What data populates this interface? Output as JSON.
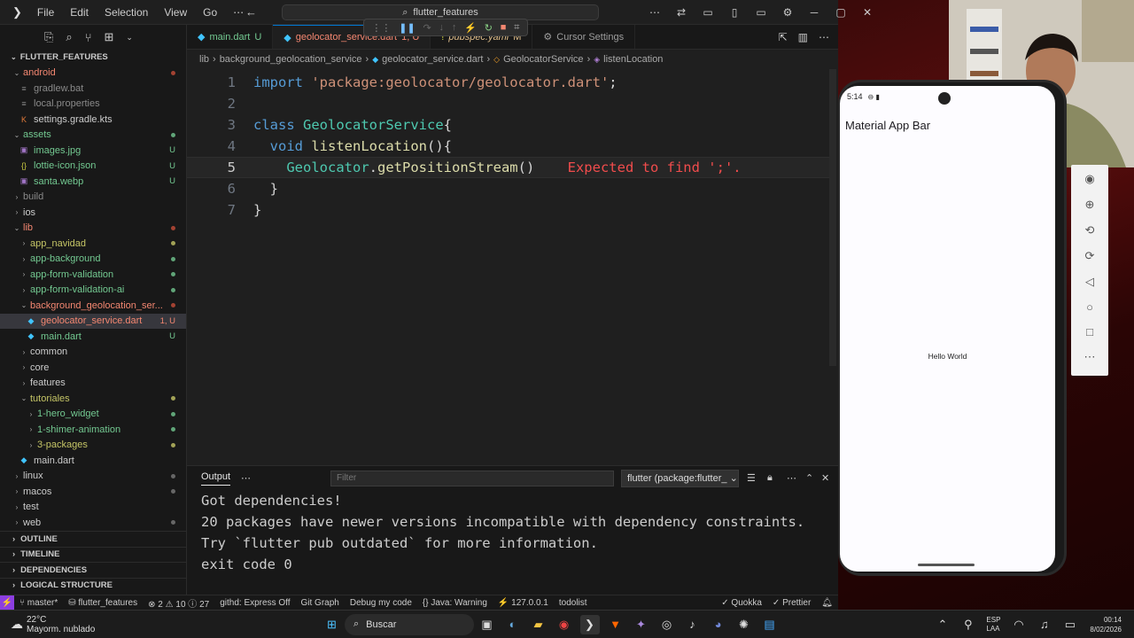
{
  "menu": {
    "items": [
      "File",
      "Edit",
      "Selection",
      "View",
      "Go",
      "⋯"
    ]
  },
  "search": {
    "text": "flutter_features"
  },
  "tabs": [
    {
      "label": "main.dart",
      "status": "U"
    },
    {
      "label": "geolocator_service.dart",
      "status": "1, U"
    },
    {
      "label": "pubspec.yaml",
      "status": "M"
    },
    {
      "label": "Cursor Settings",
      "status": ""
    }
  ],
  "breadcrumbs": [
    "lib",
    "background_geolocation_service",
    "geolocator_service.dart",
    "GeolocatorService",
    "listenLocation"
  ],
  "explorer": {
    "root": "FLUTTER_FEATURES",
    "rows": [
      {
        "label": "android",
        "indent": 1,
        "kind": "folder-open",
        "color": "#f48771",
        "status": "dot-red"
      },
      {
        "label": "gradlew.bat",
        "indent": 2,
        "kind": "file",
        "color": "#8a8a8a",
        "status": ""
      },
      {
        "label": "local.properties",
        "indent": 2,
        "kind": "file",
        "color": "#8a8a8a",
        "status": ""
      },
      {
        "label": "settings.gradle.kts",
        "indent": 2,
        "kind": "kotlin",
        "color": "#cccccc",
        "status": ""
      },
      {
        "label": "assets",
        "indent": 1,
        "kind": "folder-open",
        "color": "#73c991",
        "status": "dot-green"
      },
      {
        "label": "images.jpg",
        "indent": 2,
        "kind": "image",
        "color": "#73c991",
        "status": "U"
      },
      {
        "label": "lottie-icon.json",
        "indent": 2,
        "kind": "json",
        "color": "#73c991",
        "status": "U"
      },
      {
        "label": "santa.webp",
        "indent": 2,
        "kind": "image",
        "color": "#73c991",
        "status": "U"
      },
      {
        "label": "build",
        "indent": 1,
        "kind": "folder",
        "color": "#8a8a8a",
        "status": ""
      },
      {
        "label": "ios",
        "indent": 1,
        "kind": "folder",
        "color": "#cccccc",
        "status": ""
      },
      {
        "label": "lib",
        "indent": 1,
        "kind": "folder-open",
        "color": "#f48771",
        "status": "dot-red"
      },
      {
        "label": "app_navidad",
        "indent": 2,
        "kind": "folder",
        "color": "#c5c566",
        "status": "dot-yellow"
      },
      {
        "label": "app-background",
        "indent": 2,
        "kind": "folder",
        "color": "#73c991",
        "status": "dot-green"
      },
      {
        "label": "app-form-validation",
        "indent": 2,
        "kind": "folder",
        "color": "#73c991",
        "status": "dot-green"
      },
      {
        "label": "app-form-validation-ai",
        "indent": 2,
        "kind": "folder",
        "color": "#73c991",
        "status": "dot-green"
      },
      {
        "label": "background_geolocation_ser...",
        "indent": 2,
        "kind": "folder-open",
        "color": "#f48771",
        "status": "dot-red"
      },
      {
        "label": "geolocator_service.dart",
        "indent": 3,
        "kind": "dart",
        "color": "#f48771",
        "status": "1, U",
        "selected": true
      },
      {
        "label": "main.dart",
        "indent": 3,
        "kind": "dart",
        "color": "#73c991",
        "status": "U"
      },
      {
        "label": "common",
        "indent": 2,
        "kind": "folder",
        "color": "#cccccc",
        "status": ""
      },
      {
        "label": "core",
        "indent": 2,
        "kind": "folder",
        "color": "#cccccc",
        "status": ""
      },
      {
        "label": "features",
        "indent": 2,
        "kind": "folder",
        "color": "#cccccc",
        "status": ""
      },
      {
        "label": "tutoriales",
        "indent": 2,
        "kind": "folder-open",
        "color": "#c5c566",
        "status": "dot-yellow"
      },
      {
        "label": "1-hero_widget",
        "indent": 3,
        "kind": "folder",
        "color": "#73c991",
        "status": "dot-green"
      },
      {
        "label": "1-shimer-animation",
        "indent": 3,
        "kind": "folder",
        "color": "#73c991",
        "status": "dot-green"
      },
      {
        "label": "3-packages",
        "indent": 3,
        "kind": "folder",
        "color": "#c5c566",
        "status": "dot-yellow"
      },
      {
        "label": "main.dart",
        "indent": 2,
        "kind": "dart",
        "color": "#cccccc",
        "status": ""
      },
      {
        "label": "linux",
        "indent": 1,
        "kind": "folder",
        "color": "#cccccc",
        "status": "dot-gray"
      },
      {
        "label": "macos",
        "indent": 1,
        "kind": "folder",
        "color": "#cccccc",
        "status": "dot-gray"
      },
      {
        "label": "test",
        "indent": 1,
        "kind": "folder",
        "color": "#cccccc",
        "status": ""
      },
      {
        "label": "web",
        "indent": 1,
        "kind": "folder",
        "color": "#cccccc",
        "status": "dot-gray"
      }
    ],
    "sections": [
      "OUTLINE",
      "TIMELINE",
      "DEPENDENCIES",
      "LOGICAL STRUCTURE"
    ]
  },
  "editor": {
    "line_numbers": [
      "1",
      "2",
      "3",
      "4",
      "5",
      "6",
      "7"
    ],
    "line1": {
      "kw": "import",
      "str": "'package:geolocator/geolocator.dart'",
      "end": ";"
    },
    "line3": {
      "kw": "class",
      "cls": "GeolocatorService",
      "end": "{"
    },
    "line4": {
      "kw": "void",
      "fn": "listenLocation",
      "end": "(){"
    },
    "line5": {
      "cls": "Geolocator",
      "dot": ".",
      "fn": "getPositionStream",
      "end": "()",
      "error": "Expected to find ';'."
    },
    "line6": "}",
    "line7": "}"
  },
  "panel": {
    "tab": "Output",
    "filter_placeholder": "Filter",
    "channel": "flutter (package:flutter_",
    "lines": [
      "Got dependencies!",
      "20 packages have newer versions incompatible with dependency constraints.",
      "Try `flutter pub outdated` for more information.",
      "exit code 0"
    ]
  },
  "statusbar": {
    "branch": "master*",
    "project": "flutter_features",
    "problems": "2",
    "warnings": "10",
    "info": "27",
    "items": [
      "githd: Express Off",
      "Git Graph",
      "Debug my code",
      "Java: Warning",
      "127.0.0.1",
      "todolist"
    ],
    "right": [
      "Quokka",
      "Prettier"
    ]
  },
  "phone": {
    "time": "5:14",
    "appbar_title": "Material App Bar",
    "body_text": "Hello World"
  },
  "taskbar": {
    "temp": "22°C",
    "weather": "Mayorm. nublado",
    "search": "Buscar",
    "lang1": "ESP",
    "lang2": "LAA",
    "time": "00:14",
    "date": "8/02/2026"
  },
  "colors": {
    "accent": "#0078d4",
    "error": "#f14c4c",
    "remote": "#8c3ee0"
  }
}
